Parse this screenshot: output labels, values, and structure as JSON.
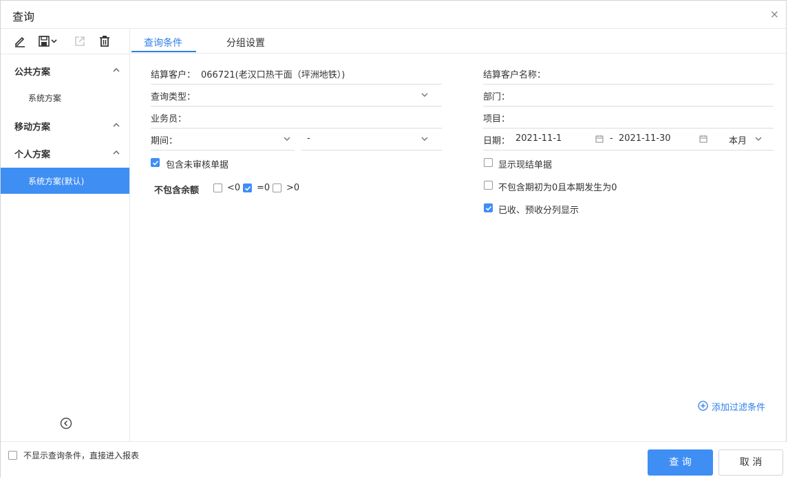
{
  "dialog": {
    "title": "查询",
    "close_symbol": "×"
  },
  "sidebar": {
    "groups": [
      {
        "label": "公共方案",
        "items": [
          {
            "label": "系统方案"
          }
        ]
      },
      {
        "label": "移动方案",
        "items": []
      },
      {
        "label": "个人方案",
        "items": [
          {
            "label": "系统方案(默认)",
            "active": true
          }
        ]
      }
    ]
  },
  "tabs": [
    {
      "label": "查询条件",
      "active": true
    },
    {
      "label": "分组设置"
    }
  ],
  "form": {
    "customer": {
      "label": "结算客户：",
      "value": "066721(老汉口热干面（坪洲地铁）)"
    },
    "customer_name": {
      "label": "结算客户名称：",
      "value": ""
    },
    "query_type": {
      "label": "查询类型：",
      "value": ""
    },
    "department": {
      "label": "部门：",
      "value": ""
    },
    "salesperson": {
      "label": "业务员：",
      "value": ""
    },
    "project": {
      "label": "项目：",
      "value": ""
    },
    "period": {
      "label": "期间：",
      "from": "",
      "separator": "-",
      "to": ""
    },
    "date": {
      "label": "日期：",
      "from": "2021-11-1",
      "separator": "-",
      "to": "2021-11-30",
      "preset": "本月"
    },
    "include_unaudited": {
      "label": "包含未审核单据",
      "checked": true
    },
    "show_cash_settled": {
      "label": "显示现结单据",
      "checked": false
    },
    "exclude_zero": {
      "label": "不包含期初为0且本期发生为0",
      "checked": false
    },
    "split_received": {
      "label": "已收、预收分列显示",
      "checked": true
    },
    "exclude_balance": {
      "label": "不包含余额",
      "options": [
        {
          "label": "<0",
          "checked": false
        },
        {
          "label": "=0",
          "checked": true
        },
        {
          "label": ">0",
          "checked": false
        }
      ]
    },
    "add_filter": "添加过滤条件"
  },
  "footer": {
    "skip_conditions": {
      "label": "不显示查询条件，直接进入报表",
      "checked": false
    },
    "query_button": "查 询",
    "cancel_button": "取 消"
  },
  "colors": {
    "accent": "#3f8ef4",
    "tab_active": "#2f7fe8"
  }
}
